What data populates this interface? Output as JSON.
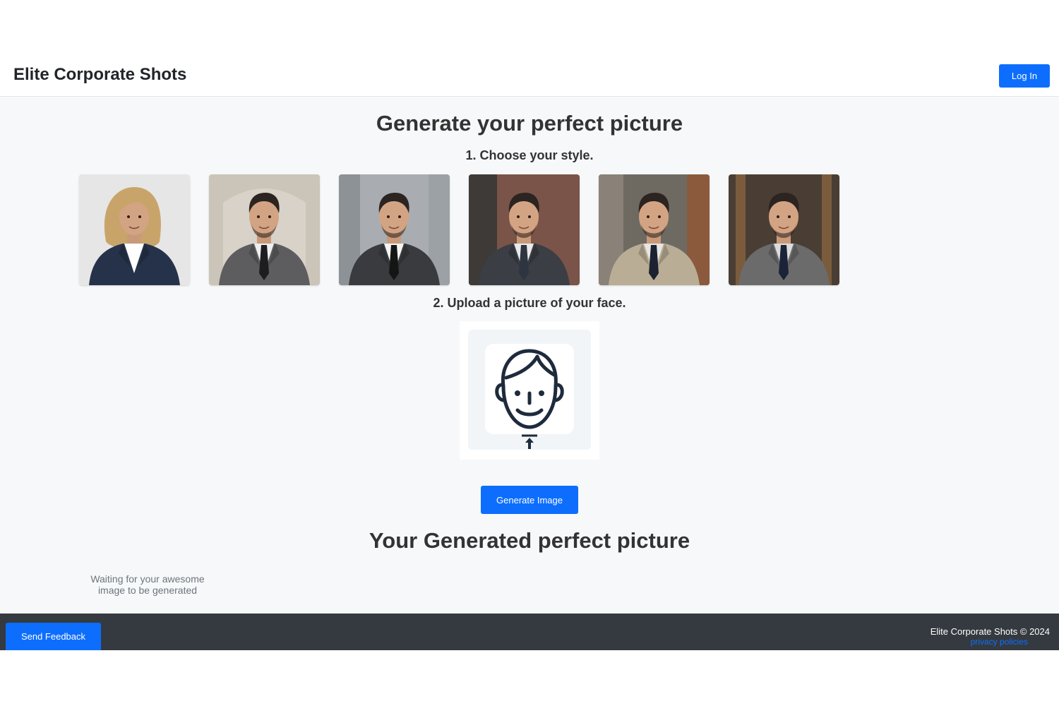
{
  "header": {
    "brand": "Elite Corporate Shots",
    "login_label": "Log In"
  },
  "main": {
    "title": "Generate your perfect picture",
    "step1": "1. Choose your style.",
    "styles": [
      {
        "name": "style-woman-navy-blazer",
        "suit": "#26324a",
        "shirt": "#ffffff",
        "tie": "none",
        "bg": "#e6e6e6",
        "hair": "#c9a46a"
      },
      {
        "name": "style-grey-suit-arch",
        "suit": "#5d5d5f",
        "shirt": "#efefef",
        "tie": "#1d1d1f",
        "bg": "#cbc4b8",
        "hair": "#2b2420"
      },
      {
        "name": "style-charcoal-suit-city",
        "suit": "#3a3b3e",
        "shirt": "#f4f4f4",
        "tie": "#151515",
        "bg": "#a9adb1",
        "hair": "#2b2420"
      },
      {
        "name": "style-dark-suit-brick",
        "suit": "#3b3e44",
        "shirt": "#e9e9e9",
        "tie": "#2e3440",
        "bg": "#7a5448",
        "hair": "#2b2420"
      },
      {
        "name": "style-beige-suit-office",
        "suit": "#b9ad95",
        "shirt": "#e7e6e2",
        "tie": "#1c2230",
        "bg": "#6e6a62",
        "hair": "#2b2420"
      },
      {
        "name": "style-grey-suit-wood",
        "suit": "#6b6b6b",
        "shirt": "#dcdcdc",
        "tie": "#1a2338",
        "bg": "#4a3e34",
        "hair": "#2b2420"
      }
    ],
    "step2": "2. Upload a picture of your face.",
    "generate_label": "Generate Image",
    "result_title": "Your Generated perfect picture",
    "waiting_text": "Waiting for your awesome image to be generated"
  },
  "footer": {
    "feedback_label": "Send Feedback",
    "copyright": "Elite Corporate Shots © 2024",
    "privacy_label": "privacy policies"
  },
  "colors": {
    "primary": "#0d6efd",
    "footer_bg": "#343a40",
    "main_bg": "#f7f8fa"
  }
}
